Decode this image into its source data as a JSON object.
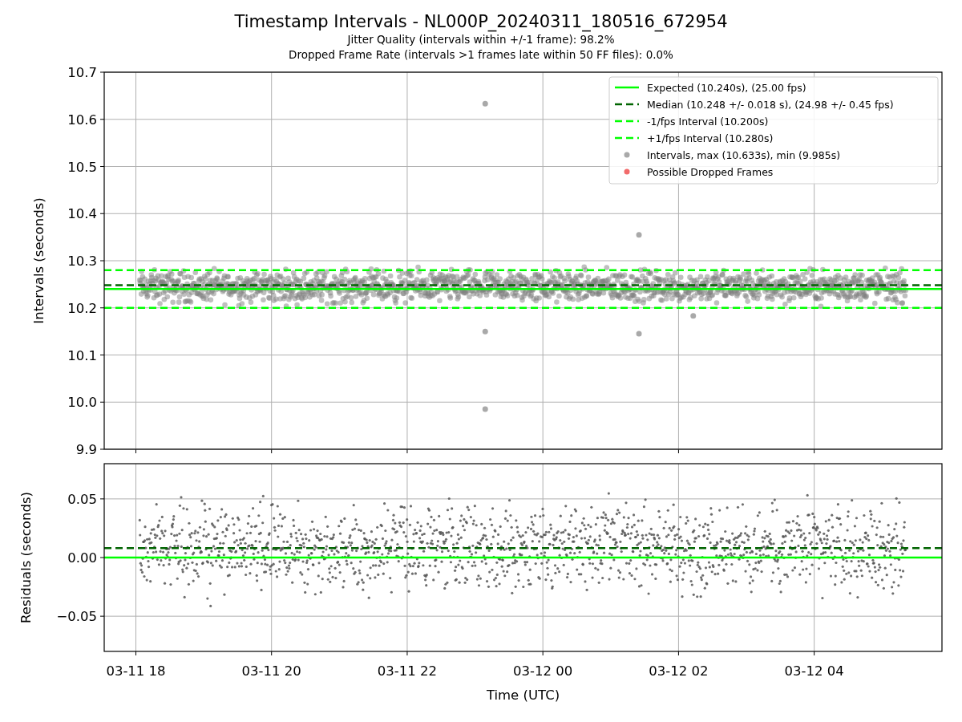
{
  "figure": {
    "title": "Timestamp Intervals - NL000P_20240311_180516_672954",
    "subtitles": [
      "Jitter Quality (intervals within +/-1 frame): 98.2%",
      "Dropped Frame Rate (intervals >1 frames late within 50 FF files): 0.0%"
    ]
  },
  "panels": [
    {
      "chart_data": {
        "type": "scatter",
        "ylabel": "Intervals (seconds)",
        "grid": true,
        "legend": "upper right",
        "xlim": [
          "2024-03-11 17:32",
          "2024-03-12 05:53"
        ],
        "ylim": [
          9.9,
          10.7
        ],
        "yticks": [
          {
            "value": 9.9,
            "label": "9.9"
          },
          {
            "value": 10.0,
            "label": "10.0"
          },
          {
            "value": 10.1,
            "label": "10.1"
          },
          {
            "value": 10.2,
            "label": "10.2"
          },
          {
            "value": 10.3,
            "label": "10.3"
          },
          {
            "value": 10.4,
            "label": "10.4"
          },
          {
            "value": 10.5,
            "label": "10.5"
          },
          {
            "value": 10.6,
            "label": "10.6"
          },
          {
            "value": 10.7,
            "label": "10.7"
          }
        ],
        "ref_lines": [
          {
            "axis": "y",
            "value": 10.24,
            "label": "Expected (10.240s), (25.00 fps)",
            "color": "#00ff00"
          },
          {
            "axis": "y",
            "value": 10.248,
            "label": "Median (10.248 +/- 0.018 s), (24.98 +/- 0.45 fps)",
            "color": "#006400"
          },
          {
            "axis": "y",
            "value": 10.2,
            "label": "-1/fps Interval (10.200s)",
            "color": "#00ff00"
          },
          {
            "axis": "y",
            "value": 10.28,
            "label": "+1/fps Interval (10.280s)",
            "color": "#00ff00"
          }
        ],
        "x": [
          "2024-03-11 23:09",
          "2024-03-11 23:09",
          "2024-03-11 23:09",
          "2024-03-12 01:25",
          "2024-03-12 01:25",
          "2024-03-12 02:13"
        ],
        "series": [
          {
            "name": "Intervals, max (10.633s), min (9.985s)",
            "color": "#a9a9a9",
            "values": [
              10.633,
              10.15,
              9.985,
              10.355,
              10.145,
              10.183
            ]
          },
          {
            "name": "Possible Dropped Frames",
            "color": "#f26b6b",
            "values": [
              null,
              null,
              null,
              null,
              null,
              null
            ]
          }
        ]
      }
    },
    {
      "chart_data": {
        "type": "scatter",
        "xlabel": "Time (UTC)",
        "ylabel": "Residuals (seconds)",
        "grid": true,
        "xlim": [
          "2024-03-11 17:32",
          "2024-03-12 05:53"
        ],
        "ylim": [
          -0.08,
          0.08
        ],
        "xticks": [
          {
            "value": "2024-03-11 18:00",
            "label": "03-11 18"
          },
          {
            "value": "2024-03-11 20:00",
            "label": "03-11 20"
          },
          {
            "value": "2024-03-11 22:00",
            "label": "03-11 22"
          },
          {
            "value": "2024-03-12 00:00",
            "label": "03-12 00"
          },
          {
            "value": "2024-03-12 02:00",
            "label": "03-12 02"
          },
          {
            "value": "2024-03-12 04:00",
            "label": "03-12 04"
          }
        ],
        "yticks": [
          {
            "value": -0.05,
            "label": "−0.05"
          },
          {
            "value": 0,
            "label": "0.00"
          },
          {
            "value": 0.05,
            "label": "0.05"
          }
        ],
        "ref_lines": [
          {
            "axis": "y",
            "value": 0,
            "color": "#00ff00"
          },
          {
            "axis": "y",
            "value": 0.008,
            "color": "#006400"
          }
        ]
      }
    }
  ]
}
